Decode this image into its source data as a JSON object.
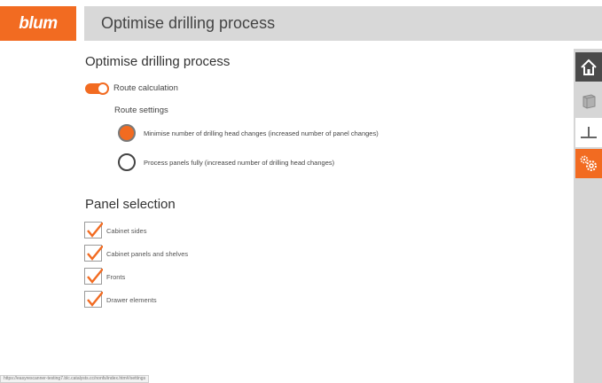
{
  "header": {
    "logo_text": "blum",
    "title": "Optimise drilling process"
  },
  "colors": {
    "accent": "#f26b21",
    "sidebar": "#d6d6d6",
    "titlebar": "#d8d8d8"
  },
  "section_drilling": {
    "heading": "Optimise drilling process",
    "toggle_label": "Route calculation",
    "toggle_on": true,
    "route_settings_label": "Route settings",
    "options": [
      {
        "label": "Minimise number of drilling head changes (increased number of panel changes)",
        "selected": true
      },
      {
        "label": "Process panels fully (increased number of drilling head changes)",
        "selected": false
      }
    ]
  },
  "section_panels": {
    "heading": "Panel selection",
    "items": [
      {
        "label": "Cabinet sides",
        "checked": true
      },
      {
        "label": "Cabinet panels and shelves",
        "checked": true
      },
      {
        "label": "Fronts",
        "checked": true
      },
      {
        "label": "Drawer elements",
        "checked": true
      }
    ]
  },
  "sidebar": {
    "icons": [
      "home-icon",
      "cabinet-icon",
      "axis-icon",
      "settings-gears-icon"
    ],
    "active": "settings-gears-icon"
  },
  "status_url": "https://easyrescanner-testing7.blc.catalysts.cc/nonfs/index.htm#/settings"
}
